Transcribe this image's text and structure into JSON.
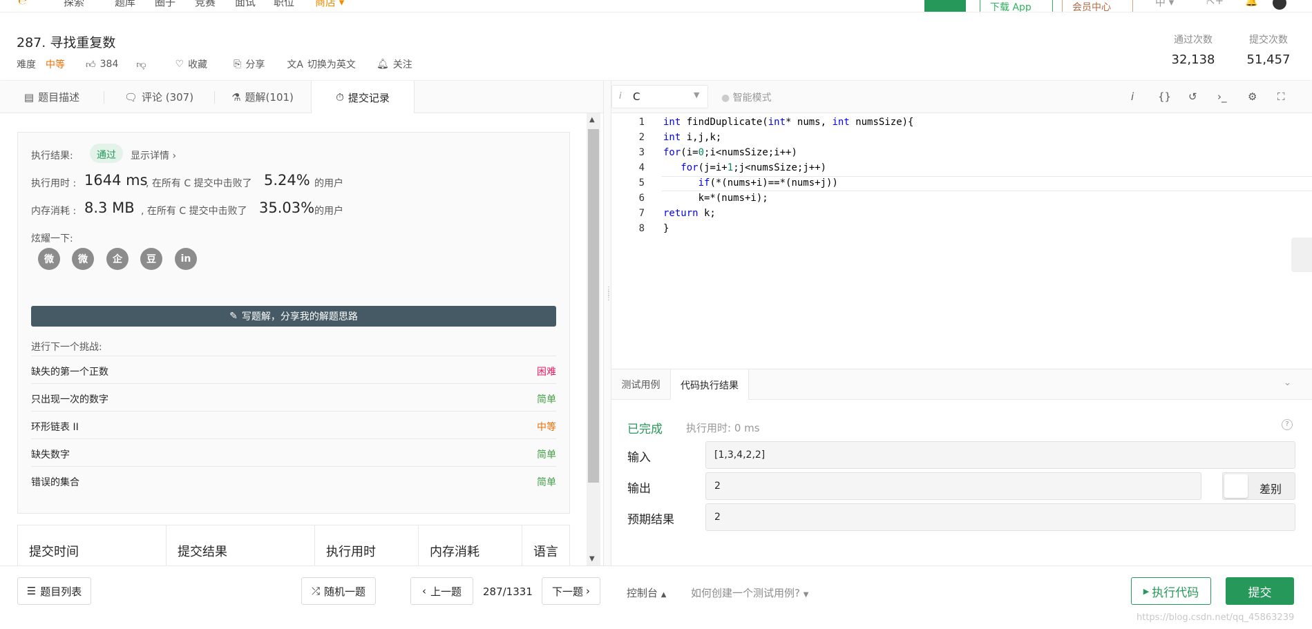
{
  "topnav": {
    "items": [
      "探索",
      "题库",
      "圈子",
      "竞赛",
      "面试",
      "职位"
    ],
    "store": "商店 ▾",
    "download": "下载 App",
    "vip": "会员中心"
  },
  "problem": {
    "title": "287. 寻找重复数",
    "difficulty_label": "难度",
    "difficulty": "中等",
    "likes": "384",
    "favorite": "收藏",
    "share": "分享",
    "switch_lang": "切换为英文",
    "follow": "关注",
    "accepted_label": "通过次数",
    "accepted": "32,138",
    "submissions_label": "提交次数",
    "submissions": "51,457"
  },
  "tabs": [
    {
      "label": "题目描述"
    },
    {
      "label": "评论 (307)"
    },
    {
      "label": "题解(101)"
    },
    {
      "label": "提交记录"
    }
  ],
  "result": {
    "label": "执行结果:",
    "status": "通过",
    "details": "显示详情 ›",
    "time_label": "执行用时 :",
    "time_value": "1644 ms",
    "time_mid": ", 在所有 C 提交中击败了",
    "time_pct": "5.24%",
    "suffix": "的用户",
    "mem_label": "内存消耗 :",
    "mem_value": "8.3 MB",
    "mem_mid": ", 在所有 C 提交中击败了",
    "mem_pct": "35.03%",
    "share_label": "炫耀一下:",
    "social": [
      "微",
      "微",
      "企",
      "豆",
      "in"
    ],
    "write_button": "写题解，分享我的解题思路",
    "next_label": "进行下一个挑战:"
  },
  "next_problems": [
    {
      "name": "缺失的第一个正数",
      "difficulty": "困难"
    },
    {
      "name": "只出现一次的数字",
      "difficulty": "简单"
    },
    {
      "name": "环形链表 II",
      "difficulty": "中等"
    },
    {
      "name": "缺失数字",
      "difficulty": "简单"
    },
    {
      "name": "错误的集合",
      "difficulty": "简单"
    }
  ],
  "submission_table": {
    "headers": [
      "提交时间",
      "提交结果",
      "执行用时",
      "内存消耗",
      "语言"
    ]
  },
  "editor": {
    "language": "C",
    "smart_mode": "智能模式",
    "icons": [
      "i",
      "{}",
      "↺",
      "›_",
      "⚙",
      "⛶"
    ],
    "line_numbers": [
      "1",
      "2",
      "3",
      "4",
      "5",
      "6",
      "7",
      "8"
    ]
  },
  "console": {
    "tabs": [
      "测试用例",
      "代码执行结果"
    ],
    "status": "已完成",
    "exec_time": "执行用时: 0 ms",
    "input_label": "输入",
    "input_value": "[1,3,4,2,2]",
    "output_label": "输出",
    "output_value": "2",
    "diff": "差别",
    "expected_label": "预期结果",
    "expected_value": "2"
  },
  "footer": {
    "problem_list": "题目列表",
    "random": "随机一题",
    "prev": "上一题",
    "counter": "287/1331",
    "next": "下一题",
    "console": "控制台",
    "howto": "如何创建一个测试用例?",
    "run": "执行代码",
    "submit": "提交",
    "watermark": "https://blog.csdn.net/qq_45863239"
  },
  "colors": {
    "accent": "#25985a",
    "medium": "#ef6c00",
    "hard": "#e91e63",
    "easy": "#43a047",
    "dark_button": "#455a64"
  }
}
